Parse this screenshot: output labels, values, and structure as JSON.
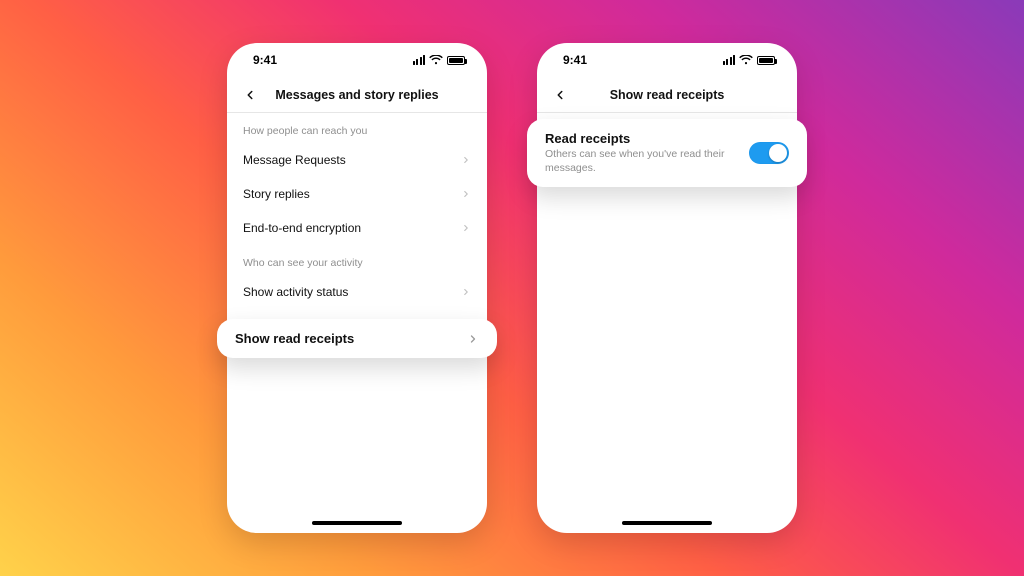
{
  "status": {
    "time": "9:41"
  },
  "left": {
    "title": "Messages and story replies",
    "section1": "How people can reach you",
    "rows1": [
      "Message Requests",
      "Story replies",
      "End-to-end encryption"
    ],
    "section2": "Who can see your activity",
    "rows2": [
      "Show activity status"
    ],
    "highlight": "Show read receipts"
  },
  "right": {
    "title": "Show read receipts",
    "card": {
      "title": "Read receipts",
      "desc": "Others can see when you've read their messages."
    }
  }
}
